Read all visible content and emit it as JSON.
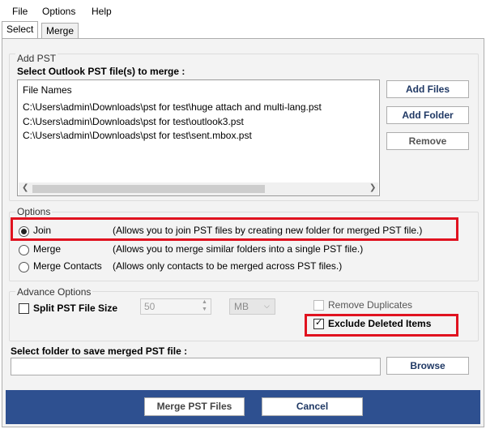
{
  "menu": {
    "file": "File",
    "options": "Options",
    "help": "Help"
  },
  "tabs": {
    "select": "Select",
    "merge": "Merge"
  },
  "add_pst": {
    "group_title": "Add PST",
    "instruction": "Select Outlook PST file(s) to merge :",
    "list_header": "File Names",
    "files": [
      "C:\\Users\\admin\\Downloads\\pst for test\\huge attach and multi-lang.pst",
      "C:\\Users\\admin\\Downloads\\pst for test\\outlook3.pst",
      "C:\\Users\\admin\\Downloads\\pst for test\\sent.mbox.pst"
    ],
    "add_files_label": "Add Files",
    "add_folder_label": "Add Folder",
    "remove_label": "Remove"
  },
  "options": {
    "group_title": "Options",
    "items": [
      {
        "label": "Join",
        "description": "(Allows you to join PST files by creating new folder for merged PST file.)",
        "checked": true
      },
      {
        "label": "Merge",
        "description": "(Allows you to merge similar folders into a single PST file.)",
        "checked": false
      },
      {
        "label": "Merge Contacts",
        "description": "(Allows only contacts to be merged across PST files.)",
        "checked": false
      }
    ]
  },
  "advance": {
    "group_title": "Advance Options",
    "split_label": "Split PST File Size",
    "split_checked": false,
    "split_value": "50",
    "split_unit": "MB",
    "remove_duplicates_label": "Remove Duplicates",
    "remove_duplicates_checked": false,
    "exclude_deleted_label": "Exclude Deleted Items",
    "exclude_deleted_checked": true
  },
  "save": {
    "label": "Select folder to save merged PST file :",
    "path_value": "",
    "browse_label": "Browse"
  },
  "footer": {
    "merge_button": "Merge PST Files",
    "cancel_button": "Cancel"
  },
  "colors": {
    "footer_bg": "#2e5090",
    "highlight": "#e0121f"
  }
}
